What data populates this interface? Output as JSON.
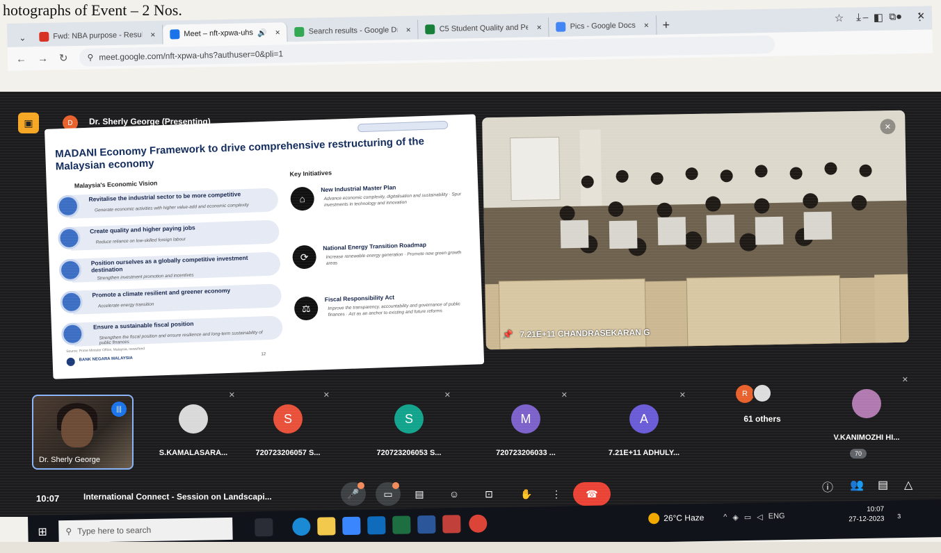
{
  "document": {
    "caption": "hotographs of Event – 2 Nos."
  },
  "browser": {
    "tabs": [
      {
        "label": "Fwd: NBA purpose - Results",
        "color": "#d93025"
      },
      {
        "label": "Meet – nft-xpwa-uhs",
        "color": "#1a73e8",
        "active": true
      },
      {
        "label": "Search results - Google Dr",
        "color": "#34a853"
      },
      {
        "label": "C5 Student Quality and Per",
        "color": "#188038"
      },
      {
        "label": "Pics - Google Docs",
        "color": "#4285f4"
      }
    ],
    "close_glyph": "×",
    "new_tab_glyph": "+",
    "url": "meet.google.com/nft-xpwa-uhs?authuser=0&pli=1",
    "window_controls": [
      "–",
      "⧉",
      "✕"
    ]
  },
  "meet": {
    "presenter": {
      "initials": "D",
      "label": "Dr. Sherly George (Presenting)"
    },
    "slide": {
      "title": "MADANI Economy Framework to drive comprehensive restructuring of the Malaysian economy",
      "vision_heading": "Malaysia's Economic Vision",
      "key_heading": "Key Initiatives",
      "vision_items": [
        {
          "title": "Revitalise the industrial sector to be more competitive",
          "sub": "Generate economic activities with higher value-add and economic complexity"
        },
        {
          "title": "Create quality and higher paying jobs",
          "sub": "Reduce reliance on low-skilled foreign labour"
        },
        {
          "title": "Position ourselves as a globally competitive investment destination",
          "sub": "Strengthen investment promotion and incentives"
        },
        {
          "title": "Promote a climate resilient and greener economy",
          "sub": "Accelerate energy transition"
        },
        {
          "title": "Ensure a sustainable fiscal position",
          "sub": "Strengthen the fiscal position and ensure resilience and long-term sustainability of public finances"
        }
      ],
      "initiatives": [
        {
          "title": "New Industrial Master Plan",
          "sub": "Advance economic complexity, digitalisation and sustainability · Spur investments in technology and innovation"
        },
        {
          "title": "National Energy Transition Roadmap",
          "sub": "Increase renewable energy generation · Promote new green growth areas"
        },
        {
          "title": "Fiscal Responsibility Act",
          "sub": "Improve the transparency, accountability and governance of public finances · Act as an anchor to existing and future reforms"
        }
      ],
      "source": "Source: Prime Minister Office, Malaysia, news/feed",
      "logo_text": "BANK NEGARA MALAYSIA",
      "page_number": "12"
    },
    "room_tile": {
      "label": "7.21E+11 CHANDRASEKARAN G"
    },
    "self_tile": {
      "name": "Dr. Sherly George"
    },
    "participants": [
      {
        "name": "S.KAMALASARA...",
        "initial": "",
        "color": "#555"
      },
      {
        "name": "720723206057 S...",
        "initial": "S",
        "color": "#e8503a"
      },
      {
        "name": "720723206053 S...",
        "initial": "S",
        "color": "#12a38c"
      },
      {
        "name": "720723206033 ...",
        "initial": "M",
        "color": "#7b61c9"
      },
      {
        "name": "7.21E+11 ADHULY...",
        "initial": "A",
        "color": "#6a5bd6"
      },
      {
        "name": "V.KANIMOZHI HI...",
        "initial": "",
        "color": "#b07ab0"
      }
    ],
    "others": {
      "initial": "R",
      "label": "61 others"
    },
    "people_count": "70",
    "time": "10:07",
    "meeting_title": "International Connect - Session on Landscapi..."
  },
  "taskbar": {
    "search_placeholder": "Type here to search",
    "weather": "26°C Haze",
    "language": "ENG",
    "time": "10:07",
    "date": "27-12-2023",
    "notification_count": "3"
  }
}
